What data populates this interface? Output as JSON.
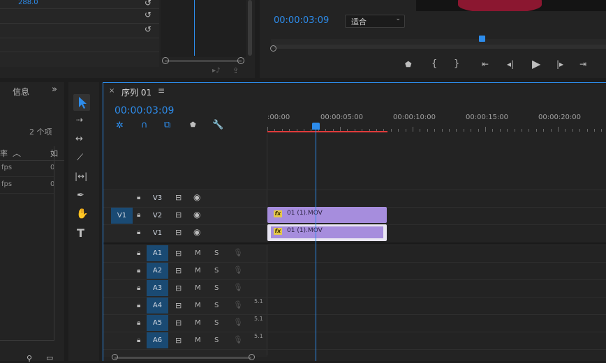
{
  "effects_panel": {
    "value": "288.0",
    "reset_icon": "reset-icon"
  },
  "program_monitor": {
    "timecode": "00:00:03:09",
    "fit_select": "适合",
    "transport_icons": [
      "add-marker-icon",
      "mark-in-icon",
      "mark-out-icon",
      "go-to-in-icon",
      "step-back-icon",
      "play-icon",
      "step-forward-icon",
      "go-to-out-icon"
    ]
  },
  "project_panel": {
    "tab_label": "信息",
    "item_count": "2 个项",
    "column_header": "率",
    "column_header_2": "如",
    "rows": [
      {
        "rate": "fps",
        "extra": "0"
      },
      {
        "rate": "fps",
        "extra": "0"
      }
    ]
  },
  "tools": [
    "selection-tool-icon",
    "track-select-tool-icon",
    "ripple-edit-tool-icon",
    "razor-tool-icon",
    "slip-tool-icon",
    "pen-tool-icon",
    "hand-tool-icon",
    "type-tool-icon"
  ],
  "sequence": {
    "close_label": "×",
    "title": "序列 01",
    "menu_label": "≡",
    "timecode": "00:00:03:09",
    "ruler_labels": [
      ":00:00",
      "00:00:05:00",
      "00:00:10:00",
      "00:00:15:00",
      "00:00:20:00"
    ],
    "video_tracks": [
      {
        "name": "V3",
        "source": ""
      },
      {
        "name": "V2",
        "source": "V1"
      },
      {
        "name": "V1",
        "source": ""
      }
    ],
    "audio_tracks": [
      {
        "name": "A1",
        "m": "M",
        "s": "S",
        "badge": ""
      },
      {
        "name": "A2",
        "m": "M",
        "s": "S",
        "badge": ""
      },
      {
        "name": "A3",
        "m": "M",
        "s": "S",
        "badge": ""
      },
      {
        "name": "A4",
        "m": "M",
        "s": "S",
        "badge": "5.1"
      },
      {
        "name": "A5",
        "m": "M",
        "s": "S",
        "badge": "5.1"
      },
      {
        "name": "A6",
        "m": "M",
        "s": "S",
        "badge": "5.1"
      }
    ],
    "clips": [
      {
        "fx": "fx",
        "name": "01 (1).MOV"
      },
      {
        "fx": "fx",
        "name": "01 (1).MOV"
      }
    ],
    "colors": {
      "clip": "#a68ddd",
      "playhead": "#2d8ceb",
      "work_area": "#e03b3b"
    }
  }
}
